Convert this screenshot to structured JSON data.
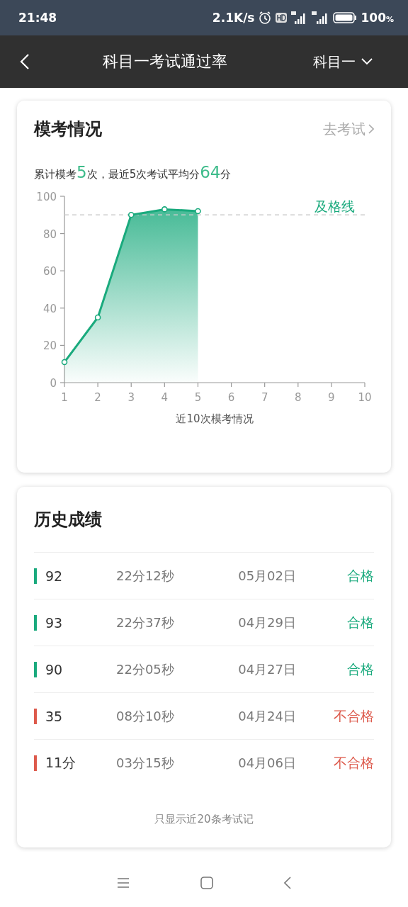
{
  "status_bar": {
    "time": "21:48",
    "speed": "2.1K/s",
    "battery": "100",
    "percent_sign": "%"
  },
  "header": {
    "title": "科目一考试通过率",
    "subject": "科目一"
  },
  "mock_card": {
    "title": "模考情况",
    "link": "去考试",
    "summary": "累计模考**5**次，最近5次考试平均分**64**分",
    "chart_data": {
      "type": "area",
      "xlabel": "近10次模考情况",
      "categories": [
        "1",
        "2",
        "3",
        "4",
        "5",
        "6",
        "7",
        "8",
        "9",
        "10"
      ],
      "series": [
        {
          "color": "#1aaa7d",
          "values": [
            11,
            35,
            90,
            93,
            92,
            null,
            null,
            null,
            null,
            null
          ]
        }
      ],
      "ylim": [
        0,
        100
      ],
      "yticks": [
        0,
        20,
        40,
        60,
        80,
        100
      ],
      "ref_lines": [
        {
          "axis": "y",
          "value": 90,
          "label": "及格线"
        }
      ]
    }
  },
  "history": {
    "title": "历史成绩",
    "rows": [
      {
        "score": "92",
        "duration": "22分12秒",
        "date": "05月02日",
        "result": "合格",
        "passed": true
      },
      {
        "score": "93",
        "duration": "22分37秒",
        "date": "04月29日",
        "result": "合格",
        "passed": true
      },
      {
        "score": "90",
        "duration": "22分05秒",
        "date": "04月27日",
        "result": "合格",
        "passed": true
      },
      {
        "score": "35",
        "duration": "08分10秒",
        "date": "04月24日",
        "result": "不合格",
        "passed": false
      },
      {
        "score": "11分",
        "duration": "03分15秒",
        "date": "04月06日",
        "result": "不合格",
        "passed": false
      }
    ],
    "footer": "只显示近20条考试记"
  }
}
